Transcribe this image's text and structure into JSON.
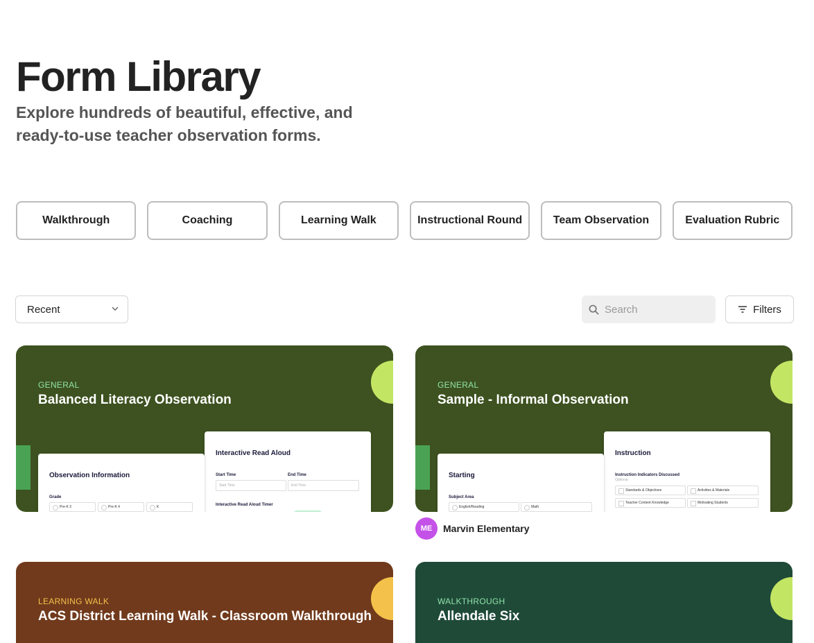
{
  "page": {
    "title": "Form Library",
    "subtitle": "Explore hundreds of beautiful, effective, and ready-to-use teacher observation forms."
  },
  "categories": [
    "Walkthrough",
    "Coaching",
    "Learning Walk",
    "Instructional Round",
    "Team Observation",
    "Evaluation Rubric"
  ],
  "toolbar": {
    "sort_value": "Recent",
    "search_placeholder": "Search",
    "filters_label": "Filters"
  },
  "cards": [
    {
      "tag": "GENERAL",
      "title": "Balanced Literacy Observation",
      "bg_color": "#3d5220",
      "tag_color": "#8fe3a8",
      "circle_color": "#c3e564",
      "preview": {
        "front_heading": "Observation Information",
        "front_label": "Grade",
        "front_options": [
          "Pre-K 3",
          "Pre-K 4",
          "K"
        ],
        "back_heading": "Interactive Read Aloud",
        "start_label": "Start Time",
        "start_placeholder": "Start Time",
        "end_label": "End Time",
        "end_placeholder": "End Time",
        "timer_label": "Interactive Read Aloud Timer"
      }
    },
    {
      "tag": "GENERAL",
      "title": "Sample - Informal Observation",
      "bg_color": "#3d5220",
      "tag_color": "#8fe3a8",
      "circle_color": "#c3e564",
      "preview": {
        "front_heading": "Starting",
        "front_label": "Subject Area",
        "front_options": [
          "English/Reading",
          "Math"
        ],
        "back_heading": "Instruction",
        "indicators_label": "Instruction Indicators Discussed",
        "indicators_note": "Optional",
        "indicators": [
          "Standards & Objectives",
          "Activities & Materials",
          "Teacher Content Knowledge",
          "Motivating Students"
        ]
      },
      "owner": {
        "initials": "ME",
        "name": "Marvin Elementary"
      }
    },
    {
      "tag": "LEARNING WALK",
      "title": "ACS District Learning Walk - Classroom Walkthrough",
      "bg_color": "#713a1c",
      "tag_color": "#f4c24a",
      "circle_color": "#f4c24a"
    },
    {
      "tag": "WALKTHROUGH",
      "title": "Allendale Six",
      "bg_color": "#1f4a38",
      "tag_color": "#8fe3a8",
      "circle_color": "#c3e564"
    }
  ]
}
